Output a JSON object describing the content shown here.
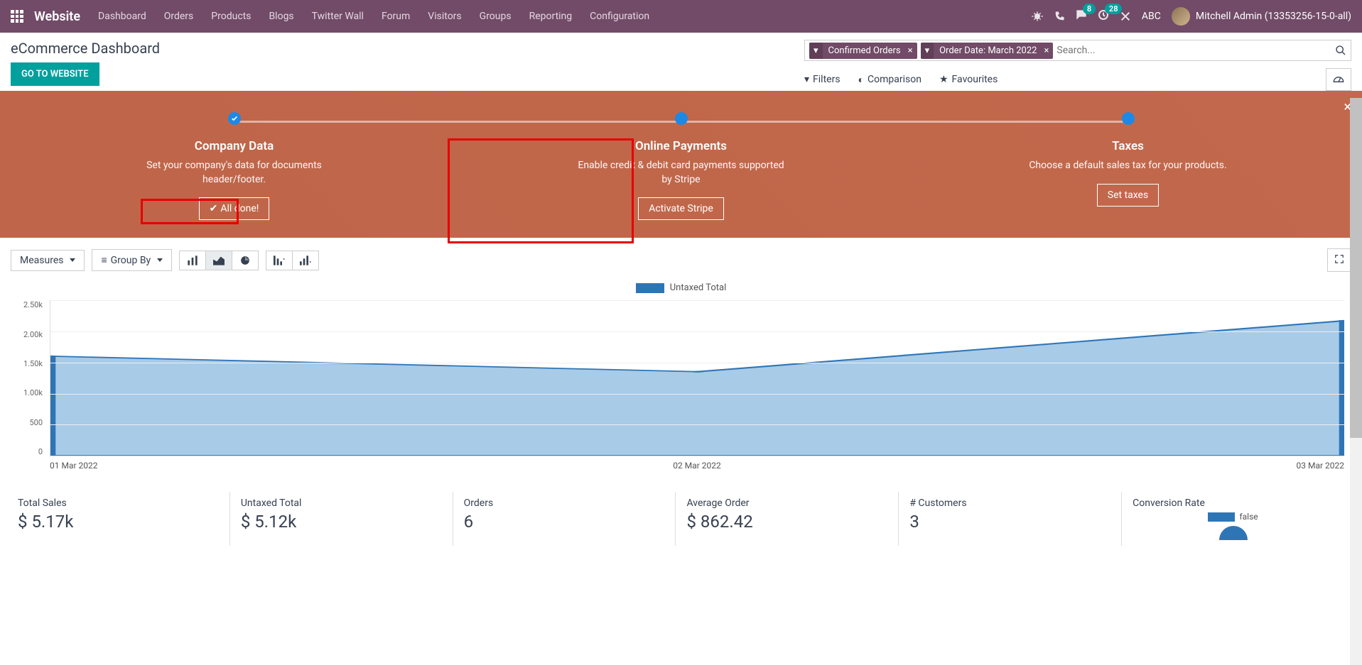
{
  "nav": {
    "brand": "Website",
    "items": [
      "Dashboard",
      "Orders",
      "Products",
      "Blogs",
      "Twitter Wall",
      "Forum",
      "Visitors",
      "Groups",
      "Reporting",
      "Configuration"
    ],
    "badges": {
      "messages": "8",
      "activities": "28"
    },
    "company": "ABC",
    "user": "Mitchell Admin (13353256-15-0-all)"
  },
  "page": {
    "title": "eCommerce Dashboard",
    "goto": "GO TO WEBSITE"
  },
  "search": {
    "facets": [
      {
        "label": "Confirmed Orders"
      },
      {
        "label": "Order Date: March 2022"
      }
    ],
    "placeholder": "Search...",
    "filters": "Filters",
    "comparison": "Comparison",
    "favourites": "Favourites"
  },
  "onboarding": {
    "steps": [
      {
        "title": "Company Data",
        "desc": "Set your company's data for documents header/footer.",
        "btn": "All done!"
      },
      {
        "title": "Online Payments",
        "desc": "Enable credit & debit card payments supported by Stripe",
        "btn": "Activate Stripe"
      },
      {
        "title": "Taxes",
        "desc": "Choose a default sales tax for your products.",
        "btn": "Set taxes"
      }
    ]
  },
  "toolbar": {
    "measures": "Measures",
    "groupby": "Group By"
  },
  "chart_data": {
    "type": "area",
    "series_name": "Untaxed Total",
    "categories": [
      "01 Mar 2022",
      "02 Mar 2022",
      "03 Mar 2022"
    ],
    "values": [
      1600,
      1350,
      2170
    ],
    "ylim": [
      0,
      2500
    ],
    "yticks": [
      "2.50k",
      "2.00k",
      "1.50k",
      "1.00k",
      "500",
      "0"
    ]
  },
  "kpis": [
    {
      "label": "Total Sales",
      "value": "$ 5.17k"
    },
    {
      "label": "Untaxed Total",
      "value": "$ 5.12k"
    },
    {
      "label": "Orders",
      "value": "6"
    },
    {
      "label": "Average Order",
      "value": "$ 862.42"
    },
    {
      "label": "# Customers",
      "value": "3"
    },
    {
      "label": "Conversion Rate",
      "value": ""
    }
  ],
  "pie_legend": "false"
}
